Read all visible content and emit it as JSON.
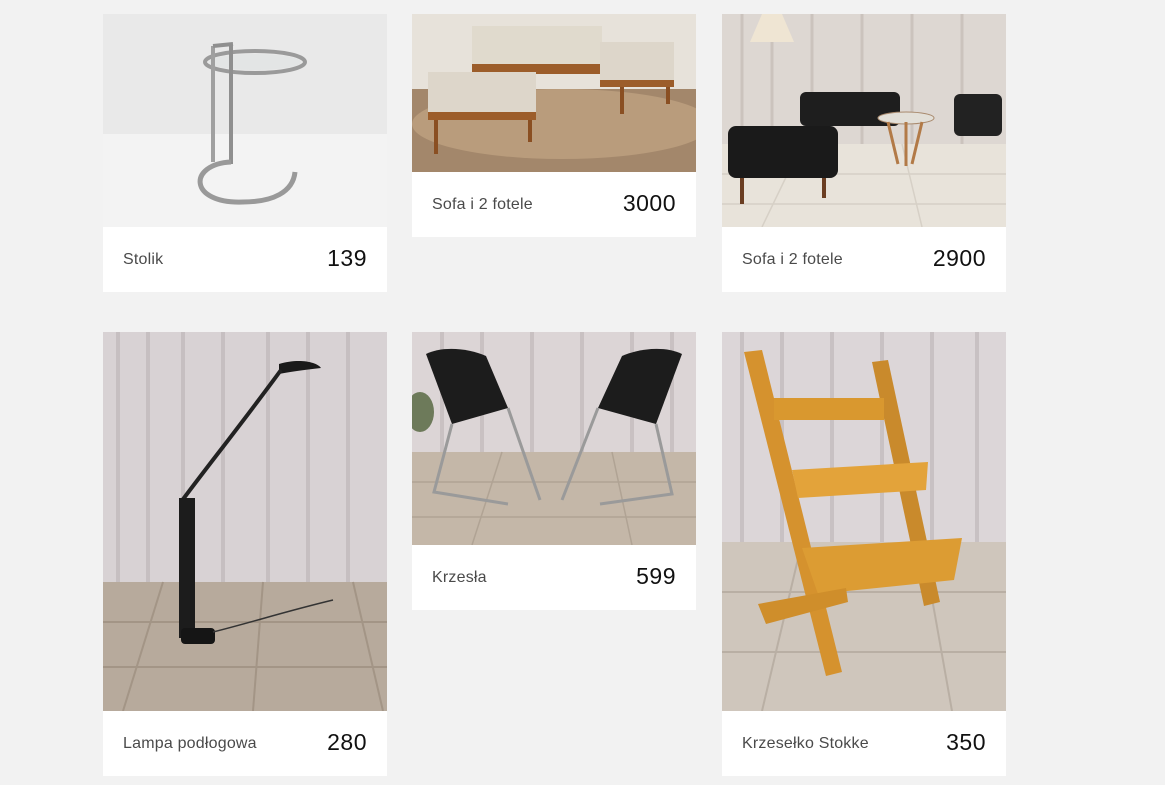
{
  "products": [
    {
      "name": "Stolik",
      "price": "139",
      "image": "glass-side-table-photo"
    },
    {
      "name": "Sofa i 2 fotele",
      "price": "3000",
      "image": "sofa-set-beige-photo"
    },
    {
      "name": "Sofa i 2 fotele",
      "price": "2900",
      "image": "leather-sofa-set-photo"
    },
    {
      "name": "Lampa podłogowa",
      "price": "280",
      "image": "floor-lamp-photo"
    },
    {
      "name": "Krzesła",
      "price": "599",
      "image": "chairs-photo"
    },
    {
      "name": "Krzesełko Stokke",
      "price": "350",
      "image": "stokke-chair-photo"
    }
  ],
  "colors": {
    "page_background": "#f2f2f2",
    "card_background": "#ffffff",
    "name_text": "#4a4a4a",
    "price_text": "#111111"
  }
}
